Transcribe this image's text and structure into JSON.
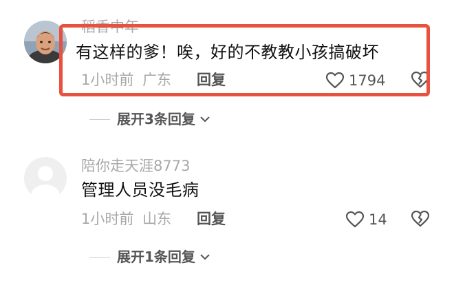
{
  "comments": [
    {
      "username": "稻香中年",
      "content": "有这样的爹！唉，好的不教教小孩搞破坏",
      "time": "1小时前",
      "location": "广东",
      "reply_label": "回复",
      "likes": "1794",
      "expand_label": "展开3条回复",
      "highlighted": true,
      "avatar": "photo"
    },
    {
      "username": "陪你走天涯8773",
      "content": "管理人员没毛病",
      "time": "1小时前",
      "location": "山东",
      "reply_label": "回复",
      "likes": "14",
      "expand_label": "展开1条回复",
      "highlighted": false,
      "avatar": "default-placeholder"
    }
  ],
  "icons": {
    "like": "heart-outline-icon",
    "dislike": "broken-heart-icon",
    "expand": "chevron-down-icon"
  },
  "colors": {
    "highlight_border": "#e8503f",
    "muted_text": "#a8a8a8",
    "action_text": "#555555"
  }
}
